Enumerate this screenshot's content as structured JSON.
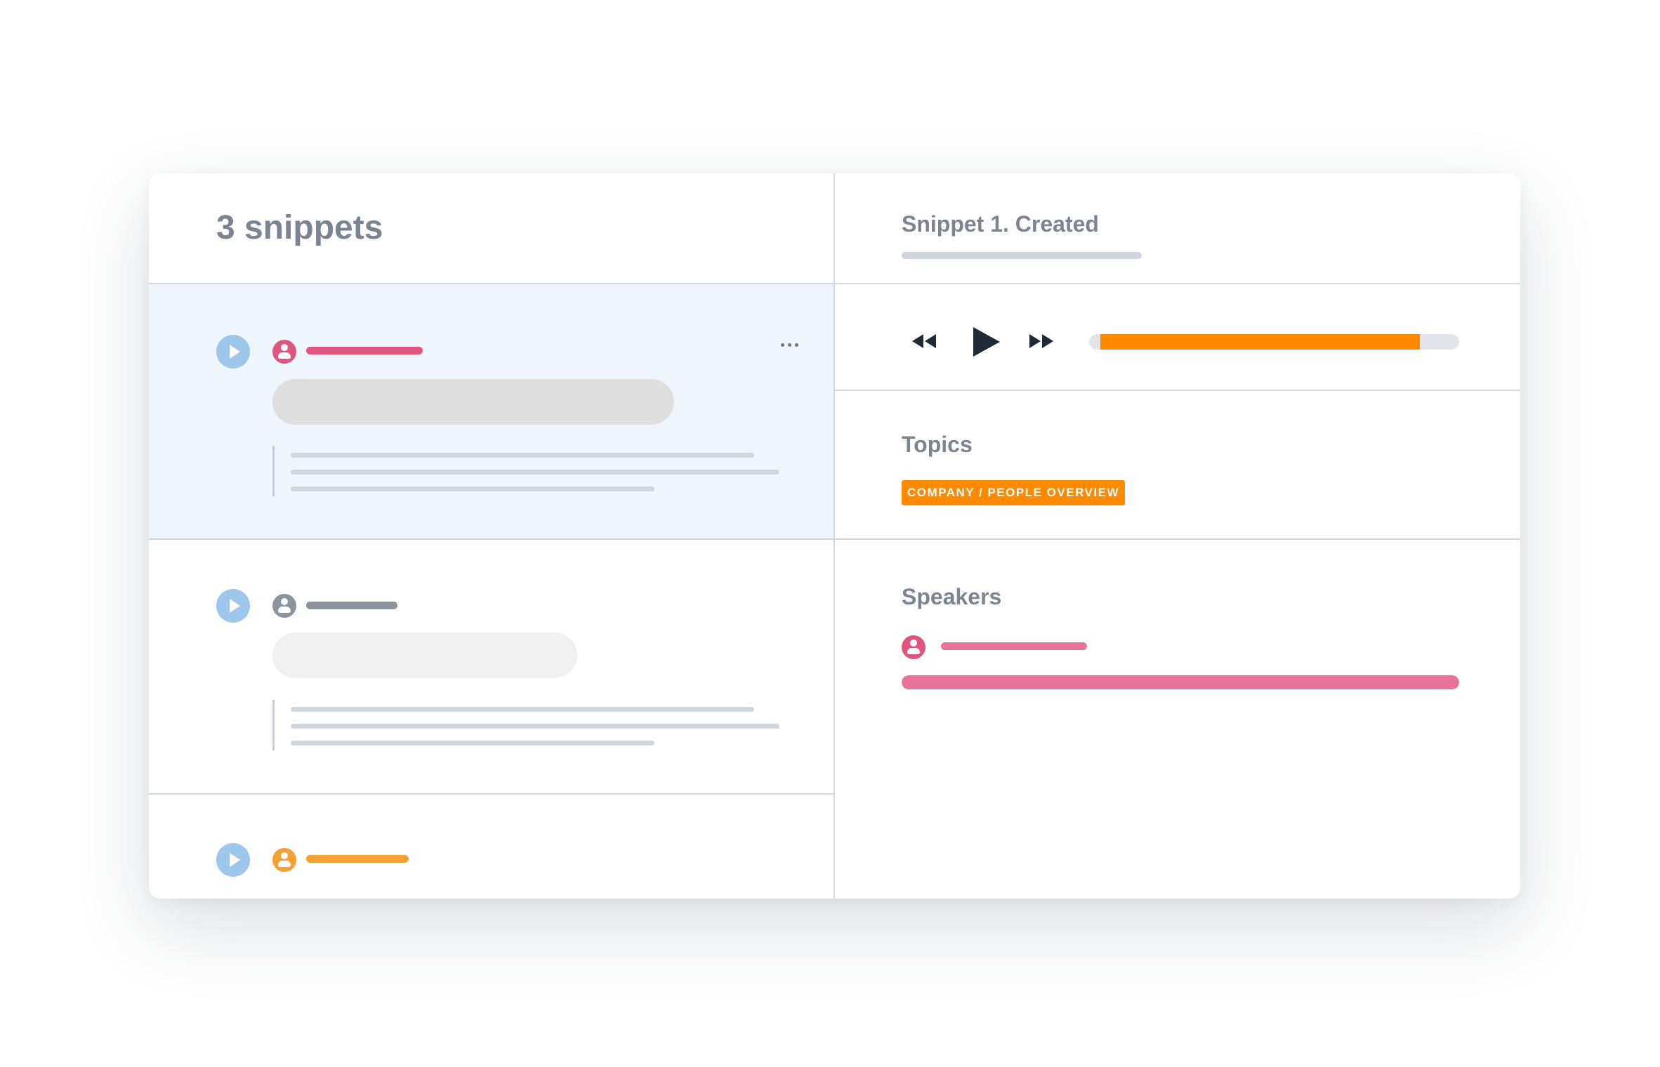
{
  "snippets_panel": {
    "title": "3 snippets",
    "snippets": [
      {
        "speaker_color": "#e0557e",
        "selected": true
      },
      {
        "speaker_color": "#8a939e",
        "selected": false
      },
      {
        "speaker_color": "#f5a033",
        "selected": false
      }
    ],
    "icons": {
      "play": "play-circle-icon",
      "avatar": "user-avatar-icon",
      "more": "more-horizontal-icon"
    }
  },
  "detail_panel": {
    "title": "Snippet 1. Created",
    "player": {
      "progress": 0.89,
      "icons": {
        "rewind": "rewind-icon",
        "play": "play-icon",
        "forward": "fast-forward-icon"
      }
    },
    "topics": {
      "label": "Topics",
      "tags": [
        "COMPANY / PEOPLE OVERVIEW"
      ]
    },
    "speakers": {
      "label": "Speakers",
      "speaker_color": "#e8739a",
      "share": 1.0
    }
  },
  "colors": {
    "accent": "#ff8a00",
    "play_button": "#9cc7ea",
    "selected_row": "#f0f6fd",
    "divider": "#d3d7de"
  }
}
